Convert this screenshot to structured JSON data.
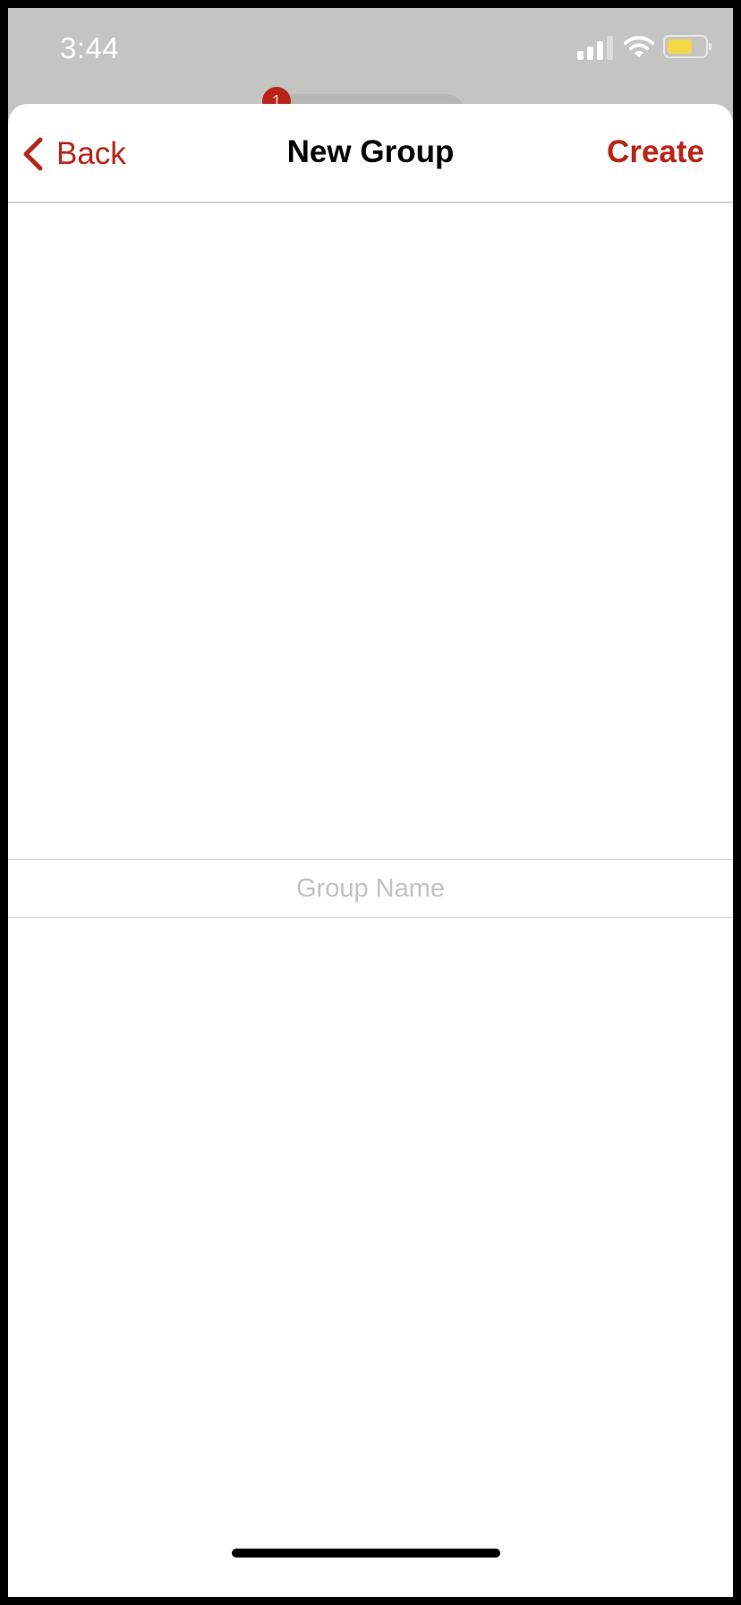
{
  "status_bar": {
    "time": "3:44",
    "icons": [
      "cellular-signal-icon",
      "wifi-icon",
      "battery-icon"
    ],
    "battery_color": "#f5d84a"
  },
  "background_card": {
    "badge_count": "1",
    "badge_color": "#b82416"
  },
  "navbar": {
    "back_label": "Back",
    "title": "New Group",
    "create_label": "Create",
    "accent_color": "#b82416"
  },
  "group_name_field": {
    "value": "",
    "placeholder": "Group Name"
  }
}
